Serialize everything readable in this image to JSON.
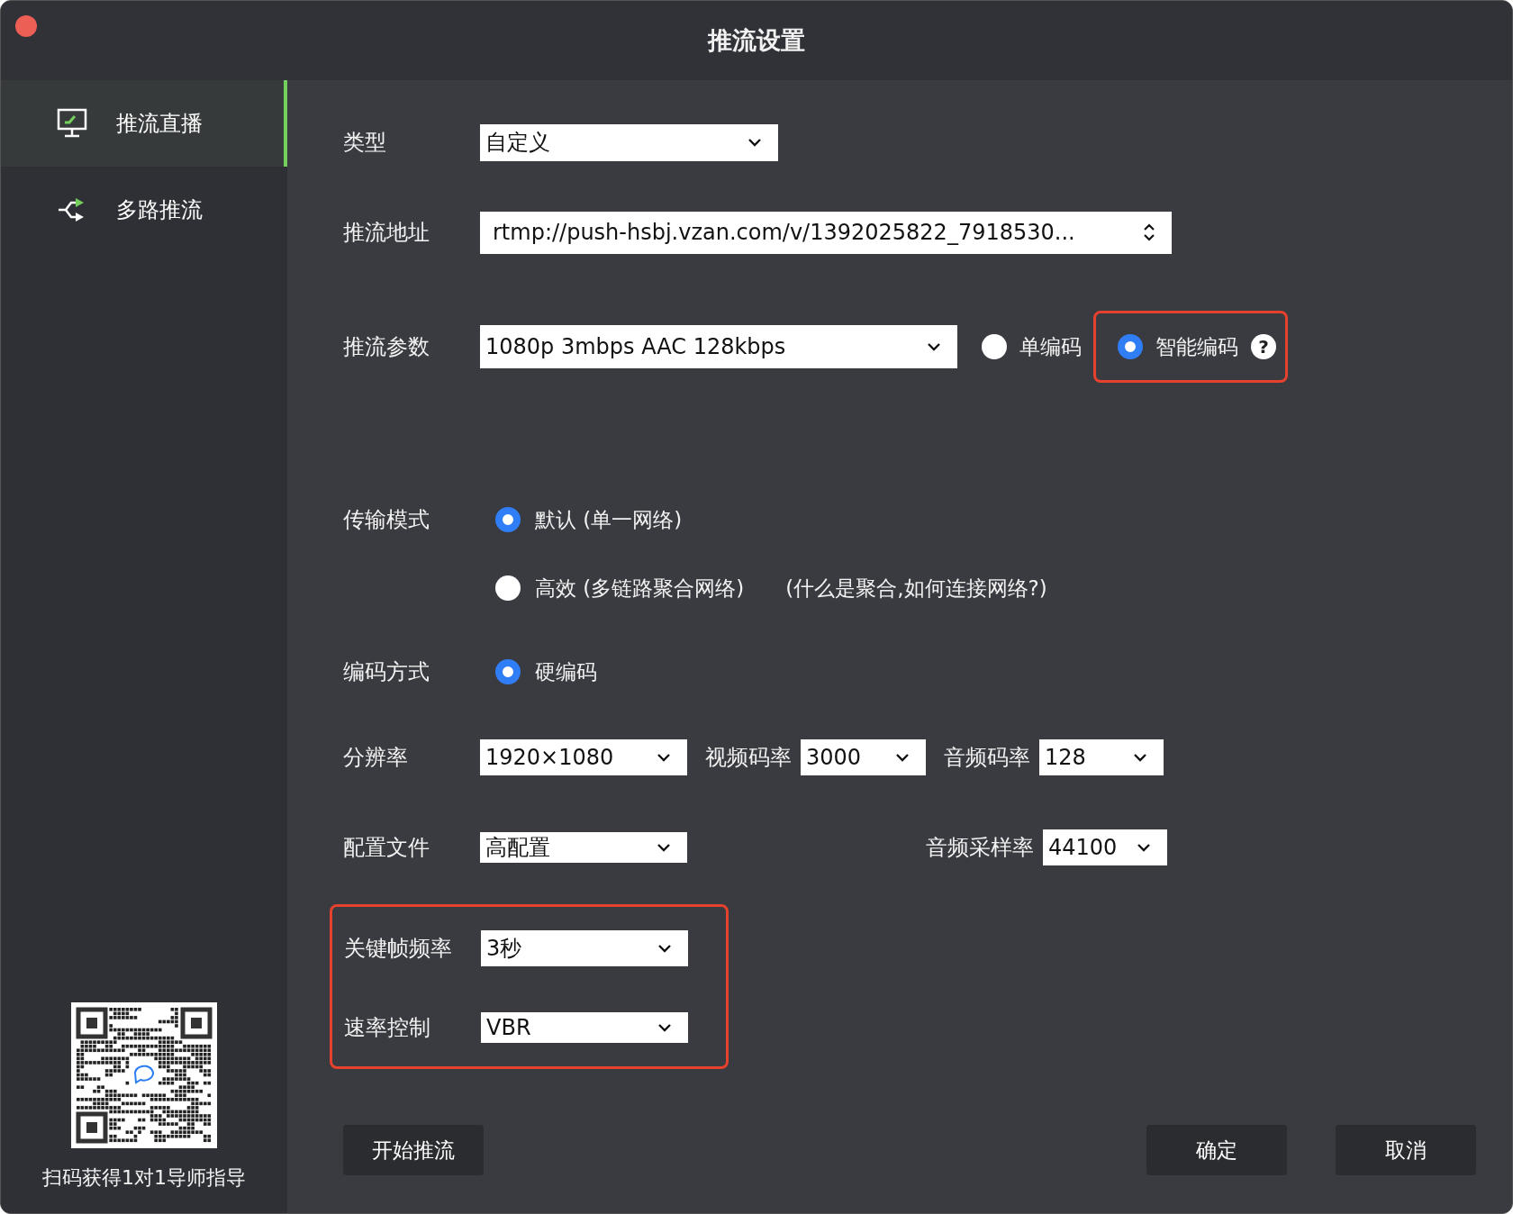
{
  "window": {
    "title": "推流设置"
  },
  "sidebar": {
    "items": [
      {
        "label": "推流直播",
        "selected": true,
        "kind": "monitor"
      },
      {
        "label": "多路推流",
        "selected": false,
        "kind": "branch"
      }
    ],
    "qr_caption": "扫码获得1对1导师指导"
  },
  "form": {
    "type": {
      "label": "类型",
      "value": "自定义"
    },
    "push_url": {
      "label": "推流地址",
      "value": "rtmp://push-hsbj.vzan.com/v/1392025822_7918530..."
    },
    "push_params": {
      "label": "推流参数",
      "value": "1080p 3mbps AAC 128kbps",
      "encoding_options": [
        {
          "label": "单编码",
          "selected": false,
          "highlighted": false
        },
        {
          "label": "智能编码",
          "selected": true,
          "highlighted": true,
          "help_icon": "?"
        }
      ]
    },
    "transport": {
      "label": "传输模式",
      "options": [
        {
          "label": "默认 (单一网络)",
          "selected": true
        },
        {
          "label": "高效 (多链路聚合网络)",
          "selected": false
        }
      ],
      "help_link": "(什么是聚合,如何连接网络?)"
    },
    "encoding": {
      "label": "编码方式",
      "options": [
        {
          "label": "硬编码",
          "selected": true
        }
      ]
    },
    "resolution": {
      "label": "分辨率",
      "value": "1920×1080"
    },
    "video_bitrate": {
      "label": "视频码率",
      "value": "3000"
    },
    "audio_bitrate": {
      "label": "音频码率",
      "value": "128"
    },
    "profile": {
      "label": "配置文件",
      "value": "高配置"
    },
    "sample_rate": {
      "label": "音频采样率",
      "value": "44100"
    },
    "rate_group": {
      "highlighted": true,
      "keyframe": {
        "label": "关键帧频率",
        "value": "3秒"
      },
      "rate_control": {
        "label": "速率控制",
        "value": "VBR"
      }
    }
  },
  "buttons": [
    {
      "label": "开始推流"
    },
    {
      "label": "确定"
    },
    {
      "label": "取消"
    }
  ]
}
